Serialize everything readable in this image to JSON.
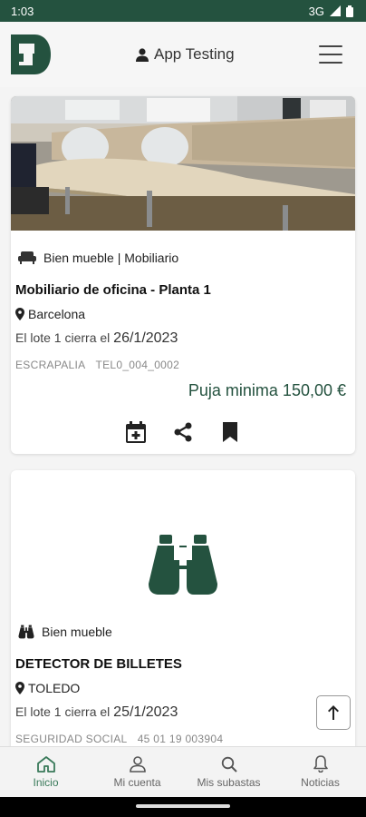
{
  "status_bar": {
    "time": "1:03",
    "network": "3G"
  },
  "header": {
    "user_label": "App Testing",
    "accent": "#24523f"
  },
  "auctions": [
    {
      "category": "Bien mueble | Mobiliario",
      "title": "Mobiliario de oficina - Planta 1",
      "location": "Barcelona",
      "closes_prefix": "El lote 1  cierra el",
      "closes_date": "26/1/2023",
      "source": "ESCRAPALIA",
      "reference": "TEL0_004_0002",
      "price_label": "Puja minima 150,00 €"
    },
    {
      "category": "Bien mueble",
      "title": "DETECTOR DE BILLETES",
      "location": "TOLEDO",
      "closes_prefix": "El lote 1  cierra el",
      "closes_date": "25/1/2023",
      "source": "SEGURIDAD SOCIAL",
      "reference": "45 01 19 003904"
    }
  ],
  "bottom_nav": [
    {
      "label": "Inicio",
      "icon": "home-icon",
      "active": true
    },
    {
      "label": "Mi cuenta",
      "icon": "user-icon",
      "active": false
    },
    {
      "label": "Mis subastas",
      "icon": "search-icon",
      "active": false
    },
    {
      "label": "Noticias",
      "icon": "bell-icon",
      "active": false
    }
  ]
}
